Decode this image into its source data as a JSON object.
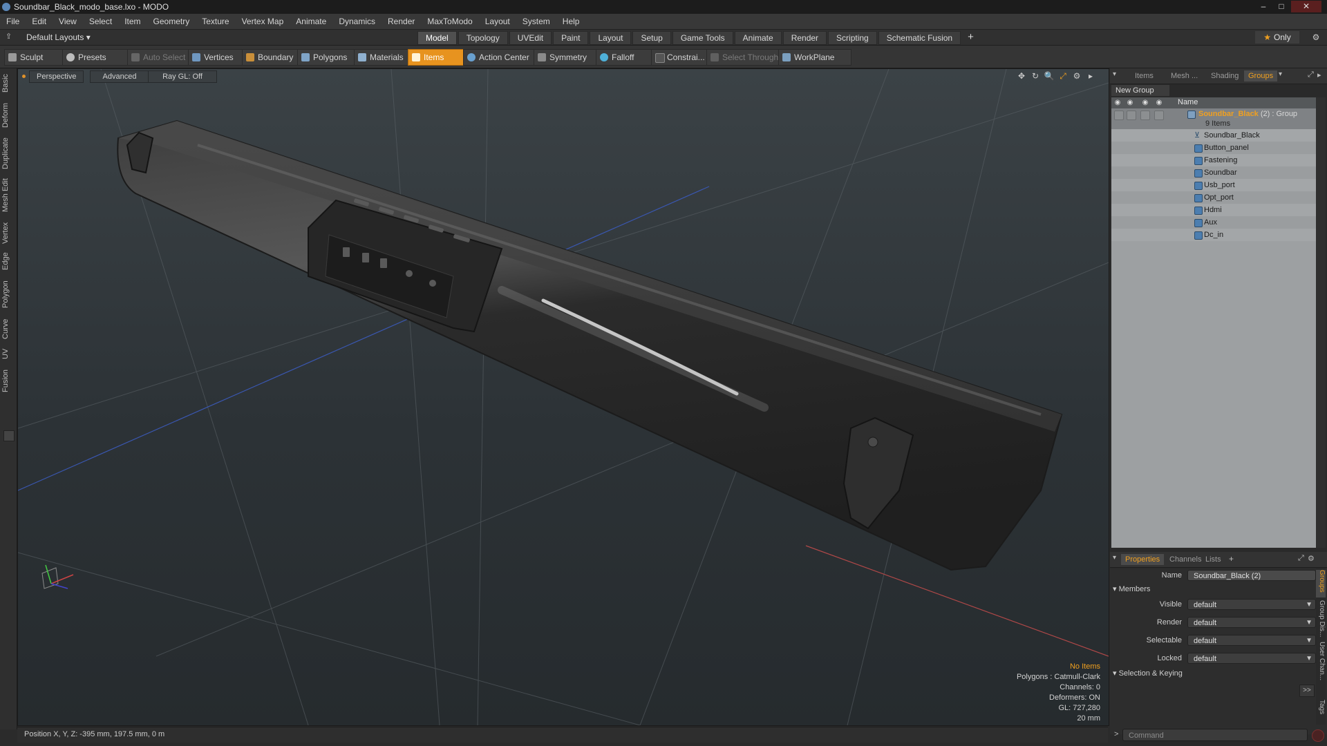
{
  "window": {
    "title": "Soundbar_Black_modo_base.lxo - MODO"
  },
  "menu": [
    "File",
    "Edit",
    "View",
    "Select",
    "Item",
    "Geometry",
    "Texture",
    "Vertex Map",
    "Animate",
    "Dynamics",
    "Render",
    "MaxToModo",
    "Layout",
    "System",
    "Help"
  ],
  "layouts": {
    "selector": "Default Layouts ▾"
  },
  "mode_tabs": [
    "Model",
    "Topology",
    "UVEdit",
    "Paint",
    "Layout",
    "Setup",
    "Game Tools",
    "Animate",
    "Render",
    "Scripting",
    "Schematic Fusion"
  ],
  "mode_active": "Model",
  "only_label": "Only",
  "toolbar": {
    "sculpt": "Sculpt",
    "presets": "Presets",
    "auto_select": "Auto Select",
    "vertices": "Vertices",
    "boundary": "Boundary",
    "polygons": "Polygons",
    "materials": "Materials",
    "items": "Items",
    "action_center": "Action Center",
    "symmetry": "Symmetry",
    "falloff": "Falloff",
    "constraints": "Constrai...",
    "select_through": "Select Through",
    "workplane": "WorkPlane"
  },
  "left_tabs": [
    "Basic",
    "Deform",
    "Duplicate",
    "Mesh Edit",
    "Vertex",
    "Edge",
    "Polygon",
    "Curve",
    "UV",
    "Fusion"
  ],
  "viewport": {
    "perspective": "Perspective",
    "advanced": "Advanced",
    "raygl": "Ray GL: Off",
    "info": {
      "no_items": "No Items",
      "polygons": "Polygons : Catmull-Clark",
      "channels": "Channels: 0",
      "deformers": "Deformers: ON",
      "gl": "GL: 727,280",
      "scale": "20 mm"
    }
  },
  "status": {
    "position": "Position X, Y, Z:  -395 mm, 197.5 mm, 0 m"
  },
  "outliner": {
    "tabs": [
      "Items",
      "Mesh ...",
      "Shading",
      "Groups"
    ],
    "active_tab": "Groups",
    "new_group": "New Group",
    "column_name": "Name",
    "group_name": "Soundbar_Black",
    "group_suffix": " (2) : Group",
    "group_count": "9 Items",
    "items": [
      "Soundbar_Black",
      "Button_panel",
      "Fastening",
      "Soundbar",
      "Usb_port",
      "Opt_port",
      "Hdmi",
      "Aux",
      "Dc_in"
    ]
  },
  "properties": {
    "tabs": [
      "Properties",
      "Channels",
      "Lists"
    ],
    "active_tab": "Properties",
    "name_label": "Name",
    "name_value": "Soundbar_Black (2)",
    "members": "Members",
    "fields": [
      {
        "label": "Visible",
        "value": "default"
      },
      {
        "label": "Render",
        "value": "default"
      },
      {
        "label": "Selectable",
        "value": "default"
      },
      {
        "label": "Locked",
        "value": "default"
      }
    ],
    "selection_keying": "Selection & Keying",
    "side_tabs": [
      "Groups",
      "Group Dis...",
      "User Chan...",
      "Tags"
    ],
    "command_placeholder": "Command"
  },
  "colors": {
    "accent": "#f0a020",
    "active_tool": "#e7931f"
  }
}
